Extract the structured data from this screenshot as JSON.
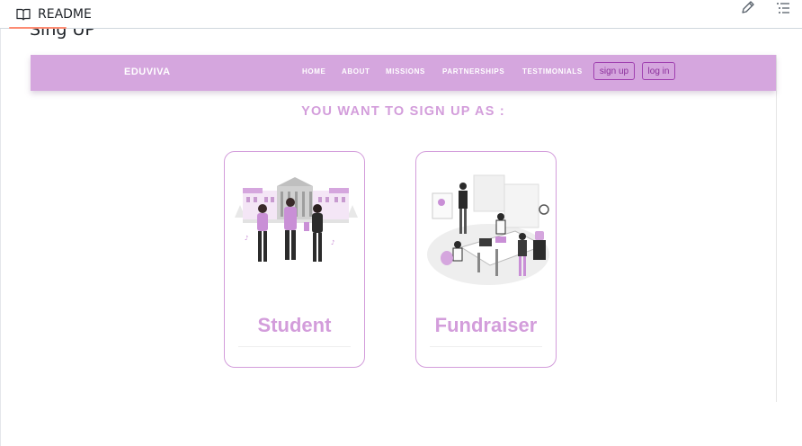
{
  "readme": {
    "tab_label": "README",
    "section_title": "Sing UP"
  },
  "site": {
    "brand": "EDUVIVA",
    "nav_links": [
      "HOME",
      "ABOUT",
      "MISSIONS",
      "PARTNERSHIPS",
      "TESTIMONIALS"
    ],
    "signup_label": "sign up",
    "login_label": "log in",
    "heading": "YOU WANT TO SIGN UP AS :",
    "cards": [
      {
        "label": "Student",
        "illustration": "students-campus-illustration"
      },
      {
        "label": "Fundraiser",
        "illustration": "office-team-illustration"
      }
    ]
  },
  "colors": {
    "accent": "#d39ddb",
    "nav_bg": "#d5a6de",
    "button_border": "#a040b0",
    "readme_underline": "#fd8c73"
  }
}
